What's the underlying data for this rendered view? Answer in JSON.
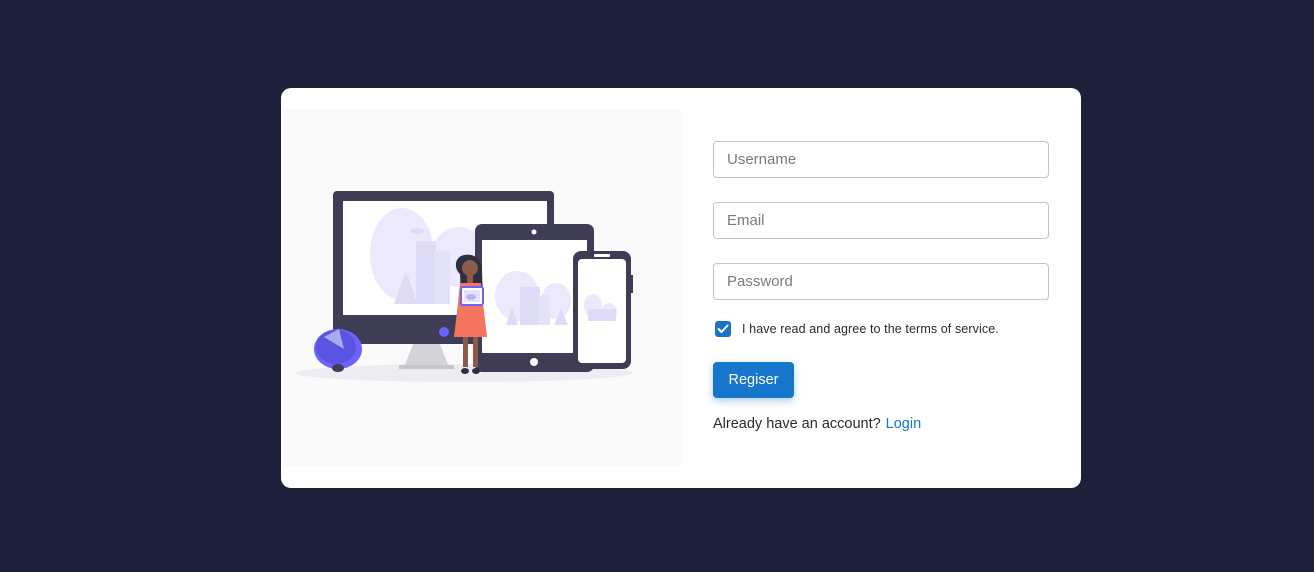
{
  "form": {
    "username_placeholder": "Username",
    "email_placeholder": "Email",
    "password_placeholder": "Password",
    "terms_label": "I have read and agree to the terms of service.",
    "terms_checked": true,
    "register_label": "Regiser",
    "account_prompt": "Already have an account?",
    "login_label": "Login"
  },
  "colors": {
    "page_background": "#1c2039",
    "primary": "#1576cc",
    "illustration_accent": "#6c63ff",
    "device_frame": "#3f3d56"
  }
}
